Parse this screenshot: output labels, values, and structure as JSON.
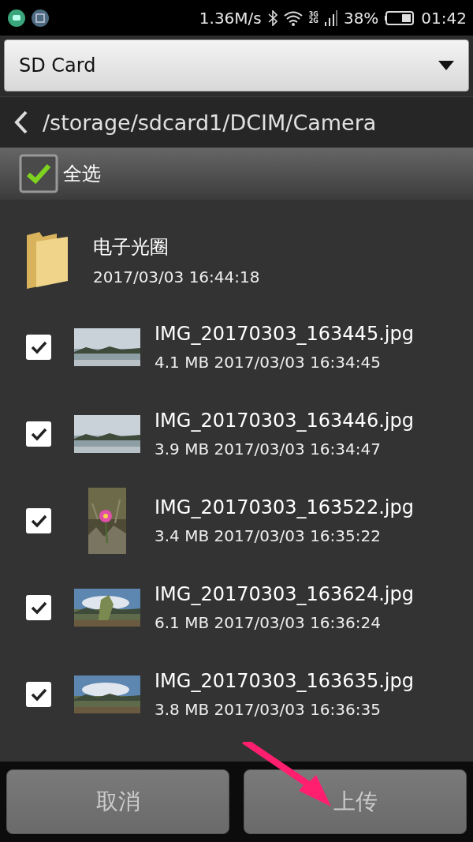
{
  "status_bar": {
    "speed": "1.36M/s",
    "network_labels": [
      "3G",
      "2G"
    ],
    "battery": "38%",
    "time": "01:42"
  },
  "storage_select": {
    "value": "SD Card"
  },
  "path_bar": {
    "path": "/storage/sdcard1/DCIM/Camera"
  },
  "select_all": {
    "label": "全选",
    "checked": true
  },
  "items": [
    {
      "kind": "folder",
      "name": "电子光圈",
      "details": "2017/03/03 16:44:18"
    },
    {
      "kind": "file",
      "name": "IMG_20170303_163445.jpg",
      "details": "4.1 MB 2017/03/03 16:34:45",
      "checked": true
    },
    {
      "kind": "file",
      "name": "IMG_20170303_163446.jpg",
      "details": "3.9 MB 2017/03/03 16:34:47",
      "checked": true
    },
    {
      "kind": "file",
      "name": "IMG_20170303_163522.jpg",
      "details": "3.4 MB 2017/03/03 16:35:22",
      "checked": true
    },
    {
      "kind": "file",
      "name": "IMG_20170303_163624.jpg",
      "details": "6.1 MB 2017/03/03 16:36:24",
      "checked": true
    },
    {
      "kind": "file",
      "name": "IMG_20170303_163635.jpg",
      "details": "3.8 MB 2017/03/03 16:36:35",
      "checked": true
    }
  ],
  "buttons": [
    {
      "label": "取消"
    },
    {
      "label": "上传"
    }
  ]
}
